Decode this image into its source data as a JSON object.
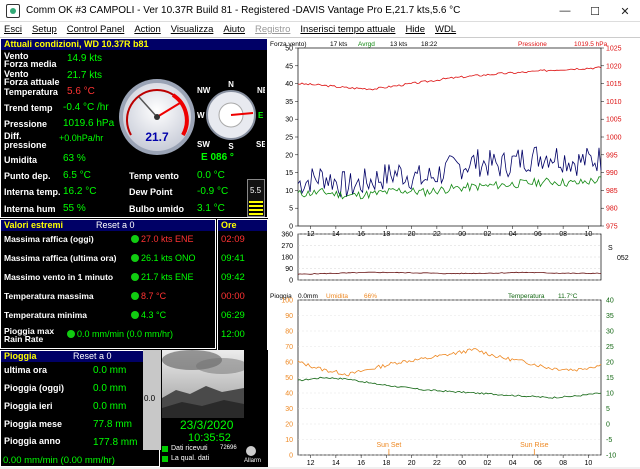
{
  "window": {
    "title": "Comm OK #3 CAMPOLI - Ver 10.37R Build 81 - Registered  -DAVIS Vantage Pro   E,21.7 kts,5.6 °C",
    "minimize": "—",
    "maximize": "☐",
    "close": "✕"
  },
  "menu": [
    {
      "label": "Esci",
      "enabled": true
    },
    {
      "label": "Setup",
      "enabled": true
    },
    {
      "label": "Control Panel",
      "enabled": true
    },
    {
      "label": "Action",
      "enabled": true
    },
    {
      "label": "Visualizza",
      "enabled": true
    },
    {
      "label": "Aiuto",
      "enabled": true
    },
    {
      "label": "Registro",
      "enabled": false
    },
    {
      "label": "Inserisci tempo attuale",
      "enabled": true
    },
    {
      "label": "Hide",
      "enabled": true
    },
    {
      "label": "WDL",
      "enabled": true
    }
  ],
  "current": {
    "header": "Attuali condizioni, WD 10.37R b81",
    "vento_label": "Vento",
    "forza_media_label": "Forza media",
    "forza_media": "14.9 kts",
    "vento_forza_label": "Vento",
    "forza_attuale_label": "Forza attuale",
    "forza_attuale": "21.7 kts",
    "temperatura_label": "Temperatura",
    "temperatura": "5.6 °C",
    "trend_temp_label": "Trend temp",
    "trend_temp": "-0.4 °C /hr",
    "pressione_label": "Pressione",
    "pressione": "1019.6 hPa",
    "diff_pressione_label": "Diff. pressione",
    "diff_pressione": "+0.0hPa/hr",
    "umidita_label": "Umidita",
    "umidita": "63 %",
    "punto_dep_label": "Punto dep.",
    "punto_dep": "6.5 °C",
    "interna_temp_label": "Interna temp.",
    "interna_temp": "16.2 °C",
    "interna_hum_label": "Interna hum",
    "interna_hum": "55 %",
    "direction": "E  086 °",
    "temp_vento_label": "Temp vento",
    "temp_vento": "0.0 °C",
    "dew_point_label": "Dew Point",
    "dew_point": "-0.9 °C",
    "bulbo_umido_label": "Bulbo umido",
    "bulbo_umido": "3.1 °C",
    "uv_value": "5.5",
    "gauge_value": "21.7",
    "compass": {
      "n": "N",
      "ne": "NE",
      "e": "E",
      "se": "SE",
      "s": "S",
      "sw": "SW",
      "w": "W",
      "nw": "NW"
    }
  },
  "extremes": {
    "header": "Valori estremi",
    "reset_label": "Reset a 0",
    "ore_header": "Ore",
    "rows": [
      {
        "label": "Massima raffica (oggi)",
        "value": "27.0 kts ENE",
        "time": "02:09",
        "value_red": true,
        "time_red": true
      },
      {
        "label": "Massima raffica (ultima ora)",
        "value": "26.1 kts ONO",
        "time": "09:41",
        "value_red": false,
        "time_red": false
      },
      {
        "label": "Massimo vento in 1 minuto",
        "value": "21.7 kts ENE",
        "time": "09:42",
        "value_red": false,
        "time_red": false
      },
      {
        "label": "Temperatura massima",
        "value": "8.7 °C",
        "time": "00:00",
        "value_red": true,
        "time_red": true
      },
      {
        "label": "Temperatura minima",
        "value": "4.3 °C",
        "time": "06:29",
        "value_red": false,
        "time_red": false
      },
      {
        "label": "Pioggia max Rain Rate",
        "value": "0.0 mm/min (0.0 mm/hr)",
        "time": "12:00",
        "value_red": false,
        "time_red": false
      }
    ]
  },
  "rain": {
    "header": "Pioggia",
    "reset_label": "Reset a 0",
    "rows": [
      {
        "label": "ultima ora",
        "value": "0.0 mm"
      },
      {
        "label": "Pioggia (oggi)",
        "value": "0.0 mm"
      },
      {
        "label": "Pioggia ieri",
        "value": "0.0 mm"
      },
      {
        "label": "Pioggia mese",
        "value": "77.8 mm"
      },
      {
        "label": "Pioggia anno",
        "value": "177.8 mm"
      }
    ],
    "rate": "0.00 mm/min (0.00 mm/hr)",
    "side_value": "0.0"
  },
  "webcam": {
    "date": "23/3/2020",
    "time": "10:35:52",
    "dati_ricevuti_label": "Dati ricevuti",
    "dati_ricevuti_value": "72696",
    "qual_dati_label": "La qual. dati",
    "alarm_label": "Allarm"
  },
  "chart_data": [
    {
      "type": "line",
      "panel": "wind-pressure",
      "header": {
        "forza_vento": "Forza vento)",
        "now": "17 kts",
        "avg_label": "Avrgd",
        "avg": "13 kts",
        "time": "18:22",
        "pressione_label": "Pressione",
        "pressione": "1019.5 hPa"
      },
      "y_left": [
        0,
        5,
        10,
        15,
        20,
        25,
        30,
        35,
        40,
        45,
        50
      ],
      "y_right": [
        975,
        980,
        985,
        990,
        995,
        1000,
        1005,
        1010,
        1015,
        1020,
        1025
      ],
      "x_ticks": [
        "12",
        "14",
        "16",
        "18",
        "20",
        "22",
        "00",
        "02",
        "04",
        "06",
        "08",
        "10"
      ],
      "series": [
        {
          "name": "Pressione",
          "color": "#dd1111",
          "values": [
            1015.0,
            1014.5,
            1013.8,
            1013.5,
            1014.5,
            1015.5,
            1016.5,
            1017.2,
            1017.8,
            1018.2,
            1018.8,
            1019.2,
            1019.5
          ]
        },
        {
          "name": "Forza vento",
          "color": "#000066",
          "values": [
            12,
            14,
            11,
            13,
            15,
            13,
            16,
            18,
            17,
            19,
            20,
            18,
            19
          ]
        },
        {
          "name": "Avrgd",
          "color": "#118811",
          "values": [
            9,
            9.5,
            8.5,
            9,
            10,
            9.5,
            10.5,
            11,
            11.5,
            12,
            12.5,
            12,
            13
          ]
        }
      ]
    },
    {
      "type": "line",
      "panel": "wind-direction",
      "y_ticks": [
        "360",
        "270",
        "180",
        "90",
        "0"
      ],
      "right_label": "S",
      "right_value": "052",
      "series": [
        {
          "name": "direzione",
          "color": "#661111",
          "values": [
            45,
            50,
            55,
            60,
            58,
            55,
            50,
            52,
            55,
            60,
            55,
            52,
            52
          ]
        }
      ]
    },
    {
      "type": "line",
      "panel": "humidity-temp",
      "header": {
        "pioggia_label": "Pioggia",
        "pioggia": "0.0mm",
        "umidita_label": "Umidita",
        "umidita": "66%",
        "temperatura_label": "Temperatura",
        "temperatura": "11.7°C"
      },
      "y_left": [
        0,
        10,
        20,
        30,
        40,
        50,
        60,
        70,
        80,
        90,
        100
      ],
      "y_right": [
        -10,
        -5,
        0,
        5,
        10,
        15,
        20,
        25,
        30,
        35,
        40
      ],
      "x_ticks": [
        "12",
        "14",
        "16",
        "18",
        "20",
        "22",
        "00",
        "02",
        "04",
        "06",
        "08",
        "10"
      ],
      "annotations": [
        "Sun Set",
        "Sun Rise"
      ],
      "series": [
        {
          "name": "Umidita",
          "color": "#ee8822",
          "values": [
            60,
            55,
            52,
            56,
            60,
            62,
            65,
            68,
            63,
            60,
            56,
            55,
            58
          ]
        },
        {
          "name": "Temperatura",
          "color": "#116611",
          "values": [
            14,
            15,
            14.5,
            13,
            12,
            11,
            10.5,
            10,
            9.5,
            9,
            8.5,
            9,
            10
          ]
        }
      ]
    }
  ]
}
